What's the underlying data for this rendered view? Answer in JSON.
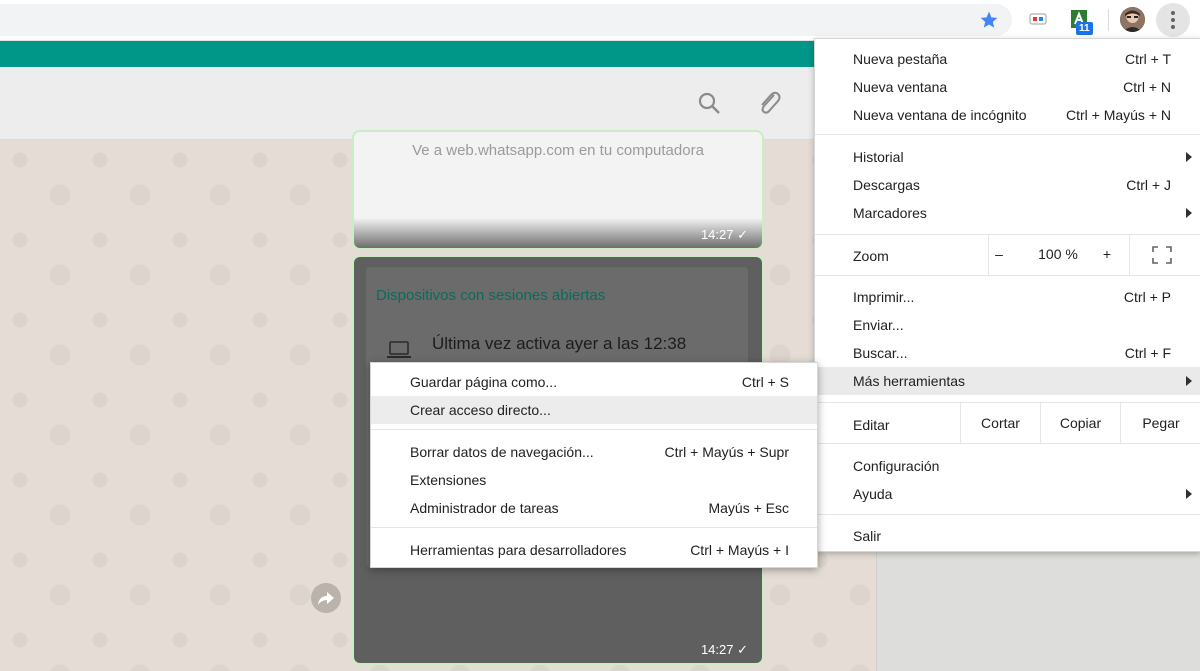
{
  "toolbar": {
    "icons": [
      "star-icon",
      "extension-icon",
      "extension-badge-icon",
      "avatar",
      "more-vert-icon"
    ],
    "extension_badge": "11",
    "accent": "#4285f4"
  },
  "whatsapp": {
    "accent": "#009688",
    "message1": {
      "text": "Ve a web.whatsapp.com en tu computadora",
      "time": "14:27 ✓"
    },
    "message2": {
      "title": "Dispositivos con sesiones abiertas",
      "session": "Última vez activa ayer a las 12:38",
      "time": "14:27 ✓"
    }
  },
  "chrome_menu": {
    "new_tab": {
      "label": "Nueva pestaña",
      "shortcut": "Ctrl + T"
    },
    "new_window": {
      "label": "Nueva ventana",
      "shortcut": "Ctrl + N"
    },
    "incognito": {
      "label": "Nueva ventana de incógnito",
      "shortcut": "Ctrl + Mayús + N"
    },
    "history": {
      "label": "Historial"
    },
    "downloads": {
      "label": "Descargas",
      "shortcut": "Ctrl + J"
    },
    "bookmarks": {
      "label": "Marcadores"
    },
    "zoom": {
      "label": "Zoom",
      "minus": "–",
      "value": "100 %",
      "plus": "+"
    },
    "print": {
      "label": "Imprimir...",
      "shortcut": "Ctrl + P"
    },
    "cast": {
      "label": "Enviar..."
    },
    "find": {
      "label": "Buscar...",
      "shortcut": "Ctrl + F"
    },
    "more_tools": {
      "label": "Más herramientas"
    },
    "edit": {
      "label": "Editar",
      "cut": "Cortar",
      "copy": "Copiar",
      "paste": "Pegar"
    },
    "settings": {
      "label": "Configuración"
    },
    "help": {
      "label": "Ayuda"
    },
    "exit": {
      "label": "Salir"
    }
  },
  "submenu": {
    "save_page": {
      "label": "Guardar página como...",
      "shortcut": "Ctrl + S"
    },
    "create_shortcut": {
      "label": "Crear acceso directo..."
    },
    "clear_data": {
      "label": "Borrar datos de navegación...",
      "shortcut": "Ctrl + Mayús + Supr"
    },
    "extensions": {
      "label": "Extensiones"
    },
    "task_manager": {
      "label": "Administrador de tareas",
      "shortcut": "Mayús + Esc"
    },
    "dev_tools": {
      "label": "Herramientas para desarrolladores",
      "shortcut": "Ctrl + Mayús + I"
    }
  }
}
